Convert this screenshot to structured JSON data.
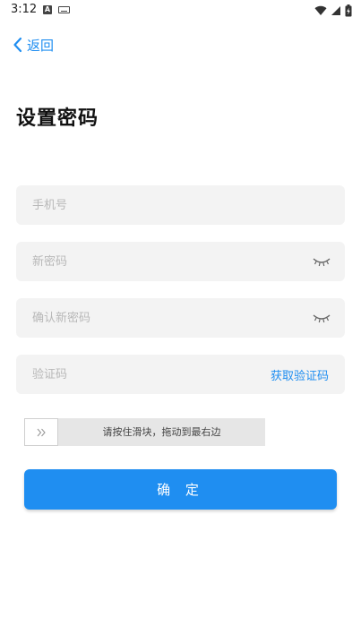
{
  "status_bar": {
    "time": "3:12",
    "notification_letter": "A"
  },
  "nav": {
    "back_label": "返回"
  },
  "page": {
    "title": "设置密码"
  },
  "form": {
    "phone_placeholder": "手机号",
    "new_password_placeholder": "新密码",
    "confirm_password_placeholder": "确认新密码",
    "code_placeholder": "验证码",
    "get_code_label": "获取验证码"
  },
  "slider": {
    "hint": "请按住滑块，拖动到最右边",
    "progress_fraction": 0
  },
  "actions": {
    "confirm_label": "确 定"
  },
  "colors": {
    "accent": "#1f8ef1",
    "field_bg": "#f3f3f3",
    "placeholder": "#b8b8b8"
  },
  "icons": {
    "back": "chevron-left-icon",
    "password_visibility": "eye-closed-icon",
    "slider_handle": "double-chevron-right-icon"
  }
}
